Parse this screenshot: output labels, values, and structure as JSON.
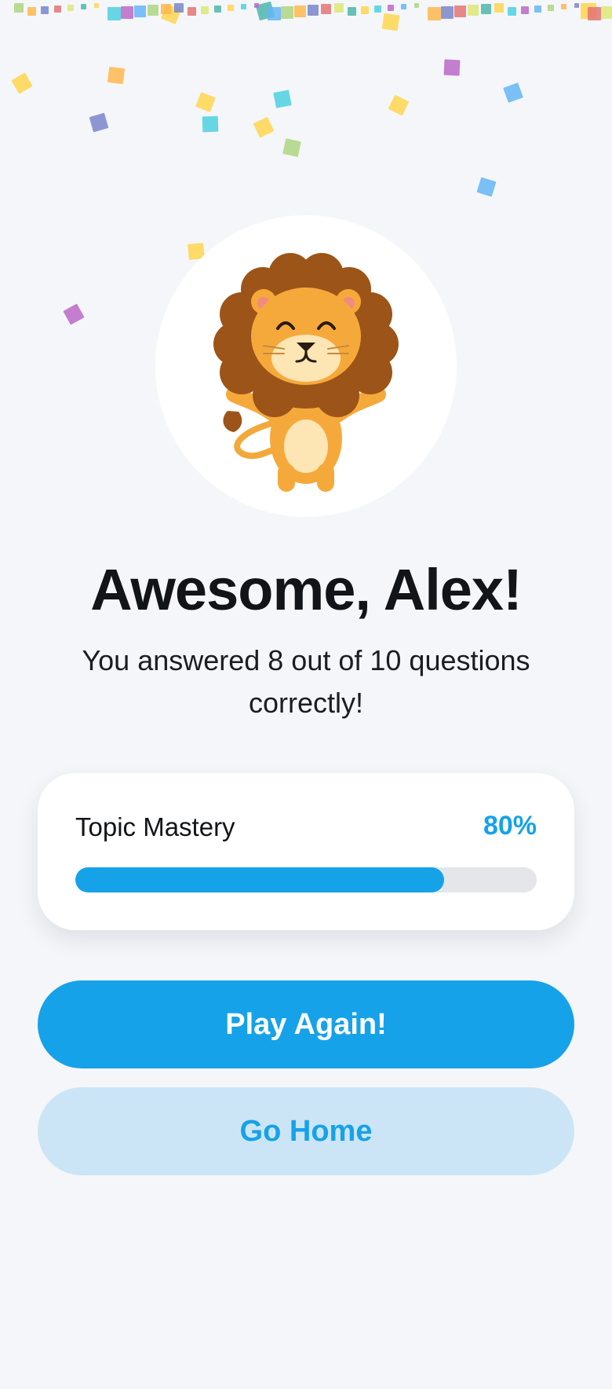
{
  "header": {
    "title": "Awesome, Alex!",
    "subtitle": "You answered 8 out of 10 questions correctly!"
  },
  "mascot": {
    "icon": "lion-mascot-icon"
  },
  "mastery": {
    "label": "Topic Mastery",
    "value_text": "80%",
    "progress": 0.8
  },
  "actions": {
    "play_again_label": "Play Again!",
    "go_home_label": "Go Home"
  },
  "colors": {
    "accent": "#16a2e8",
    "accent_light": "#cbe5f6",
    "background": "#f4f6f9",
    "confetti": [
      "#ffd54f",
      "#4dd0e1",
      "#ba68c8",
      "#64b5f6",
      "#aed581",
      "#ffb74d",
      "#7986cb",
      "#e57373",
      "#dce775",
      "#4db6ac"
    ]
  }
}
